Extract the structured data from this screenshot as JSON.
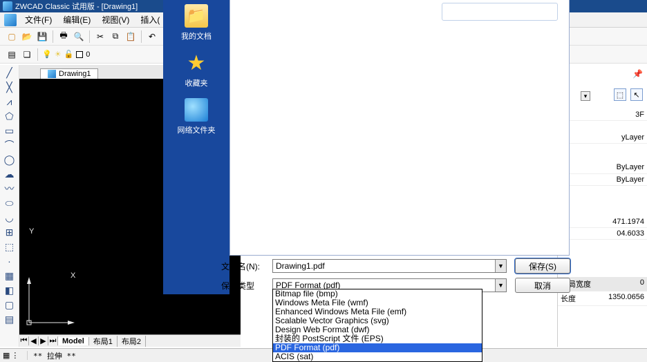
{
  "title": "ZWCAD Classic 试用版 - [Drawing1]",
  "menu": {
    "file": "文件(F)",
    "edit": "编辑(E)",
    "view": "视图(V)",
    "insert": "插入("
  },
  "layer": {
    "name": "0"
  },
  "drawing_tab": "Drawing1",
  "ucs": {
    "x": "X",
    "y": "Y"
  },
  "layout_tabs": {
    "model": "Model",
    "l1": "布局1",
    "l2": "布局2"
  },
  "sidebar": {
    "docs": "我的文档",
    "fav": "收藏夹",
    "net": "网络文件夹"
  },
  "dialog": {
    "filename_label": "文件名(N):",
    "filename_value": "Drawing1.pdf",
    "type_label": "保存类型",
    "type_value": "PDF Format (pdf)",
    "save_btn": "保存(S)",
    "cancel_btn": "取消"
  },
  "format_options": [
    "Bitmap file (bmp)",
    "Windows Meta File (wmf)",
    "Enhanced Windows Meta File (emf)",
    "Scalable Vector Graphics (svg)",
    "Design Web Format (dwf)",
    "封装的 PostScript 文件 (EPS)",
    "PDF Format (pdf)",
    "ACIS (sat)"
  ],
  "selected_format_index": 6,
  "props": {
    "color_suffix": "3F",
    "layer_val": "yLayer",
    "bylayer": "ByLayer",
    "num1": "04.6033",
    "num2": "471.1974",
    "width_label": "全局宽度",
    "width_val": "0",
    "len_label": "长度",
    "len_val": "1350.0656"
  },
  "command": "** 拉伸 **"
}
